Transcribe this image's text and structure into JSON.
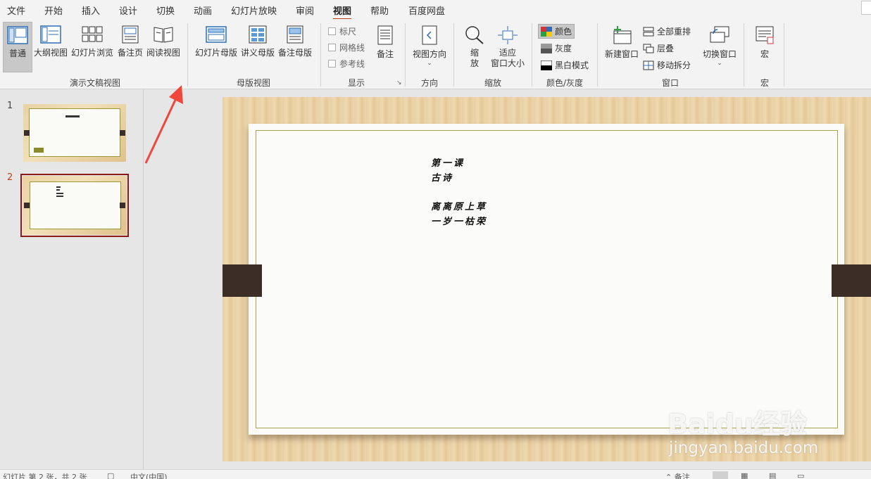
{
  "menu": {
    "items": [
      "文件",
      "开始",
      "插入",
      "设计",
      "切换",
      "动画",
      "幻灯片放映",
      "审阅",
      "视图",
      "帮助",
      "百度网盘"
    ],
    "active": "视图"
  },
  "ribbon": {
    "presentation_views": {
      "label": "演示文稿视图",
      "buttons": [
        "普通",
        "大纲视图",
        "幻灯片浏览",
        "备注页",
        "阅读视图"
      ],
      "selected": "普通"
    },
    "master_views": {
      "label": "母版视图",
      "buttons": [
        "幻灯片母版",
        "讲义母版",
        "备注母版"
      ]
    },
    "show": {
      "label": "显示",
      "checkboxes": [
        "标尺",
        "网格线",
        "参考线"
      ],
      "notes_button": "备注"
    },
    "orientation": {
      "label": "方向",
      "button": "视图方向"
    },
    "zoom": {
      "label": "缩放",
      "zoom_button_line1": "缩",
      "zoom_button_line2": "放",
      "fit_line1": "适应",
      "fit_line2": "窗口大小"
    },
    "color_grayscale": {
      "label": "颜色/灰度",
      "items": [
        "颜色",
        "灰度",
        "黑白模式"
      ],
      "selected": "颜色"
    },
    "window": {
      "label": "窗口",
      "new_window": "新建窗口",
      "items": [
        "全部重排",
        "层叠",
        "移动拆分"
      ],
      "switch": "切换窗口"
    },
    "macros": {
      "label": "宏",
      "button": "宏"
    }
  },
  "thumbnails": [
    {
      "number": "1",
      "active": false
    },
    {
      "number": "2",
      "active": true
    }
  ],
  "slide": {
    "lines": [
      "第一课",
      "古诗",
      "离离原上草",
      "一岁一枯荣"
    ]
  },
  "watermark": {
    "logo": "Baidu经验",
    "url": "jingyan.baidu.com"
  },
  "status": {
    "slide_info": "幻灯片 第 2 张，共 2 张",
    "language": "中文(中国)",
    "notes": "备注"
  },
  "colors": {
    "accent": "#c43e1c",
    "annotation_arrow": "#f0473c",
    "strap": "#3c2e27"
  }
}
